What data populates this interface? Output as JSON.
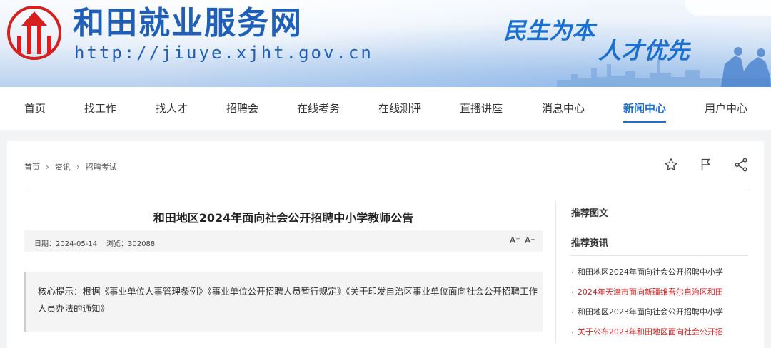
{
  "header": {
    "site_title": "和田就业服务网",
    "site_url": "http://jiuye.xjht.gov.cn",
    "slogan_line1": "民生为本",
    "slogan_line2": "人才优先",
    "brand_color": "#1f5fb8",
    "logo_color": "#d71f1f"
  },
  "nav": {
    "items": [
      {
        "label": "首页"
      },
      {
        "label": "找工作"
      },
      {
        "label": "找人才"
      },
      {
        "label": "招聘会"
      },
      {
        "label": "在线考务"
      },
      {
        "label": "在线测评"
      },
      {
        "label": "直播讲座"
      },
      {
        "label": "消息中心"
      },
      {
        "label": "新闻中心",
        "active": true
      },
      {
        "label": "用户中心"
      }
    ],
    "active_color": "#1f6fd1"
  },
  "breadcrumb": {
    "items": [
      {
        "label": "首页"
      },
      {
        "label": "资讯"
      },
      {
        "label": "招聘考试"
      }
    ]
  },
  "toolbar": {
    "icons": [
      "star-icon",
      "report-flag-icon",
      "share-icon"
    ]
  },
  "article": {
    "title": "和田地区2024年面向社会公开招聘中小学教师公告",
    "date": "日期：2024-05-14",
    "views": "浏览：302088",
    "font_increase": "A⁺",
    "font_decrease": "A⁻",
    "summary": "核心提示：根据《事业单位人事管理条例》《事业单位公开招聘人员暂行规定》《关于印发自治区事业单位面向社会公开招聘工作人员办法的通知》"
  },
  "sidebar": {
    "section1_title": "推荐图文",
    "section2_title": "推荐资讯",
    "items": [
      {
        "label": "和田地区2024年面向社会公开招聘中小学",
        "highlight": false
      },
      {
        "label": "2024年天津市面向新疆维吾尔自治区和田",
        "highlight": true
      },
      {
        "label": "和田地区2023年面向社会公开招聘中小学",
        "highlight": false
      },
      {
        "label": "关于公布2023年和田地区面向社会公开招",
        "highlight": true
      }
    ],
    "highlight_color": "#d82020"
  }
}
